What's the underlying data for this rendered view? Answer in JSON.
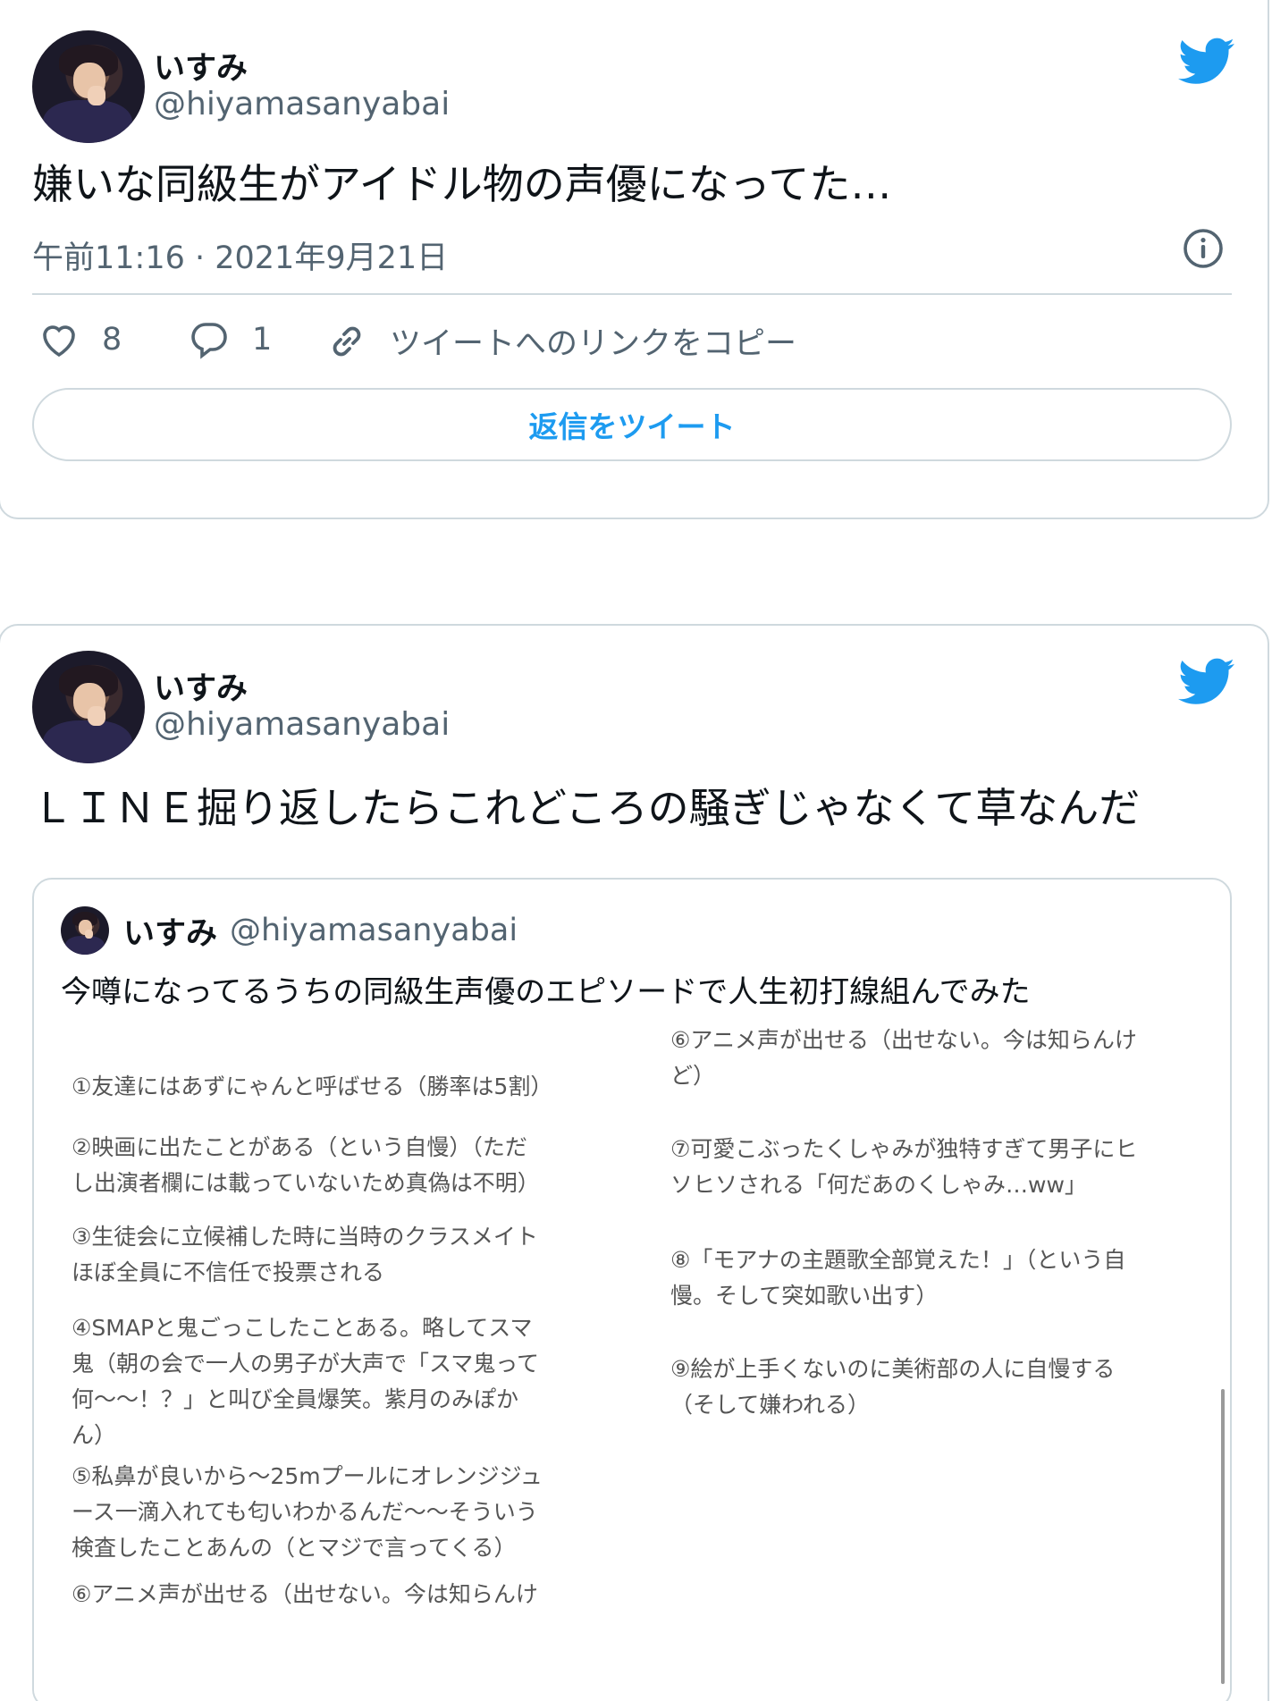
{
  "tweet1": {
    "name": "いすみ",
    "handle": "@hiyamasanyabai",
    "text": "嫌いな同級生がアイドル物の声優になってた…",
    "timestamp": "午前11:16 · 2021年9月21日",
    "likes": "8",
    "replies": "1",
    "copy_link_label": "ツイートへのリンクをコピー",
    "reply_button_label": "返信をツイート"
  },
  "tweet2": {
    "name": "いすみ",
    "handle": "@hiyamasanyabai",
    "text": "ＬＩＮＥ掘り返したらこれどころの騒ぎじゃなくて草なんだ",
    "quote": {
      "name": "いすみ",
      "handle": "@hiyamasanyabai",
      "text": "今噂になってるうちの同級生声優のエピソードで人生初打線組んでみた",
      "left_items": [
        "①友達にはあずにゃんと呼ばせる（勝率は5割）",
        "②映画に出たことがある（という自慢）（ただ\nし出演者欄には載っていないため真偽は不明）",
        "③生徒会に立候補した時に当時のクラスメイト\nほぼ全員に不信任で投票される",
        "④SMAPと鬼ごっこしたことある。略してスマ\n鬼（朝の会で一人の男子が大声で「スマ鬼って\n何〜〜！？」と叫び全員爆笑。紫月のみぽか\nん）",
        "⑤私鼻が良いから〜25mプールにオレンジジュ\nース一滴入れても匂いわかるんだ〜〜そういう\n検査したことあんの（とマジで言ってくる）",
        "⑥アニメ声が出せる（出せない。今は知らんけ"
      ],
      "right_items": [
        "⑥アニメ声が出せる（出せない。今は知らんけ\nど）",
        "⑦可愛こぶったくしゃみが独特すぎて男子にヒ\nソヒソされる「何だあのくしゃみ…ww」",
        "⑧「モアナの主題歌全部覚えた！」（という自\n慢。そして突如歌い出す）",
        "⑨絵が上手くないのに美術部の人に自慢する\n（そして嫌われる）"
      ]
    }
  },
  "colors": {
    "accent": "#1d9bf0",
    "text": "#0f1419",
    "secondary": "#536471",
    "border": "#cfd9de"
  },
  "icons": [
    "twitter-bird-icon",
    "info-icon",
    "heart-icon",
    "reply-bubble-icon",
    "link-icon"
  ]
}
